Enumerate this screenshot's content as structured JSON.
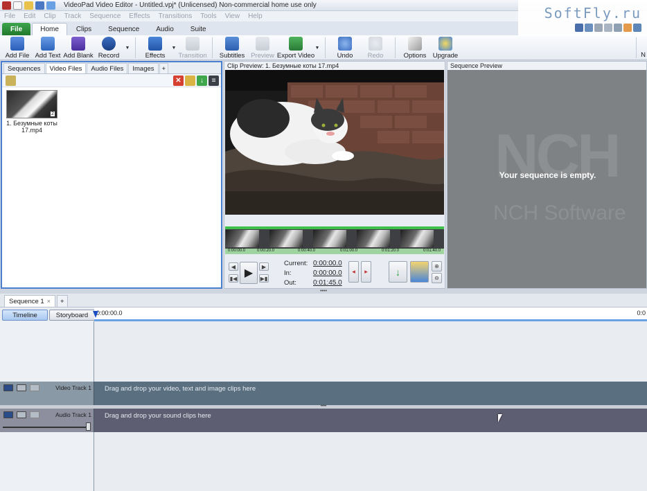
{
  "titlebar": {
    "title": "VideoPad Video Editor - Untitled.vpj* (Unlicensed) Non-commercial home use only"
  },
  "watermark": {
    "text": "SoftFly.ru"
  },
  "menu": [
    "File",
    "Edit",
    "Clip",
    "Track",
    "Sequence",
    "Effects",
    "Transitions",
    "Tools",
    "View",
    "Help"
  ],
  "ribbon_tabs": [
    "File",
    "Home",
    "Clips",
    "Sequence",
    "Audio",
    "Suite"
  ],
  "toolbar": {
    "add_file": "Add File",
    "add_text": "Add Text",
    "add_blank": "Add Blank",
    "record": "Record",
    "effects": "Effects",
    "transition": "Transition",
    "subtitles": "Subtitles",
    "preview": "Preview",
    "export_video": "Export Video",
    "undo": "Undo",
    "redo": "Redo",
    "options": "Options",
    "upgrade": "Upgrade",
    "overflow": "N"
  },
  "bin": {
    "tabs": [
      "Sequences",
      "Video Files",
      "Audio Files",
      "Images",
      "+"
    ],
    "clip_caption": "1. Безумные коты 17.mp4",
    "clip_badge": "2"
  },
  "clip_preview": {
    "header": "Clip Preview: 1. Безумные коты 17.mp4",
    "ticks": [
      "0:00:00.0",
      "0:00:20.0",
      "0:00:40.0",
      "0:01:00.0",
      "0:01:20.0",
      "0:01:40.0"
    ],
    "current_label": "Current:",
    "current_value": "0:00:00.0",
    "in_label": "In:",
    "in_value": "0:00:00.0",
    "out_label": "Out:",
    "out_value": "0:01:45.0"
  },
  "sequence_preview": {
    "header": "Sequence Preview",
    "logo": "NCH",
    "company": "NCH Software",
    "empty_message": "Your sequence is empty."
  },
  "sequence_tabs": {
    "tab": "Sequence 1",
    "close": "×",
    "add": "+"
  },
  "timeline": {
    "timeline_btn": "Timeline",
    "storyboard_btn": "Storyboard",
    "ruler_start": "0:00:00.0",
    "ruler_end": "0:0",
    "video_track": "Video Track 1",
    "video_hint": "Drag and drop your video, text and image clips here",
    "audio_track": "Audio Track 1",
    "audio_hint": "Drag and drop your sound clips here"
  },
  "colors": {
    "file_tab": "#217a2d",
    "selection_border": "#4a7fd0",
    "video_track": "#5a6f80",
    "audio_track": "#5e5e72",
    "scrub_green": "#3ec04c"
  }
}
